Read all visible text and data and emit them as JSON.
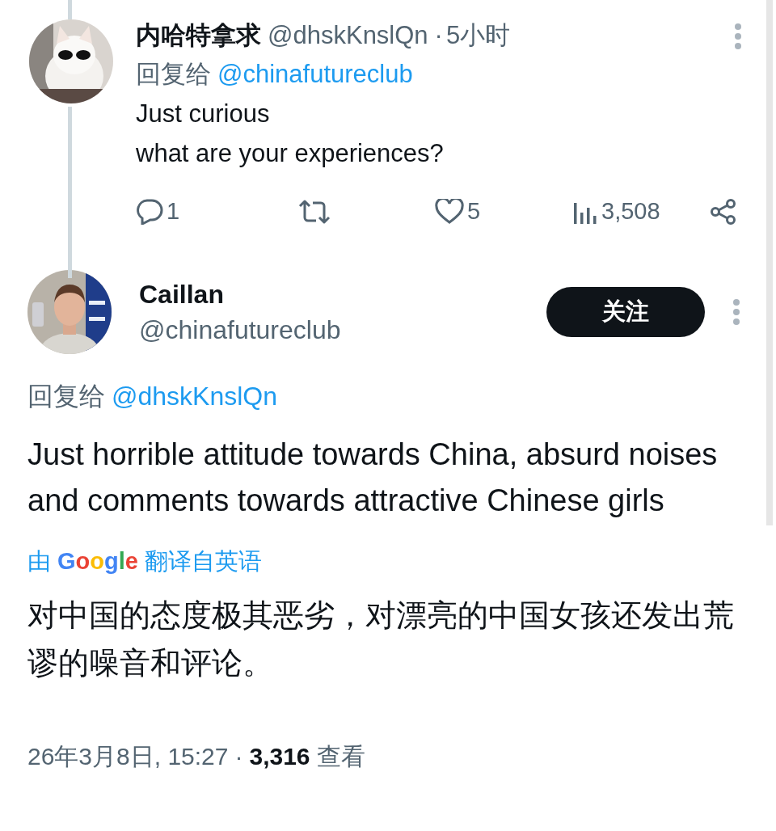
{
  "parent_tweet": {
    "display_name": "内哈特拿求",
    "handle": "@dhskKnslQn",
    "separator": "·",
    "time": "5小时",
    "reply_label": "回复给",
    "reply_to": "@chinafutureclub",
    "lines": [
      "Just curious",
      "what are your experiences?"
    ],
    "actions": [
      {
        "kind": "reply",
        "count": "1"
      },
      {
        "kind": "retweet"
      },
      {
        "kind": "like",
        "count": "5"
      },
      {
        "kind": "views",
        "count": "3,508"
      },
      {
        "kind": "share"
      }
    ]
  },
  "main_tweet": {
    "display_name": "Caillan",
    "handle": "@chinafutureclub",
    "follow_button": "关注",
    "reply_label": "回复给",
    "reply_to": "@dhskKnslQn",
    "text": "Just horrible attitude towards China, absurd noises and comments towards attractive Chinese girls",
    "translation_prefix": "由",
    "translation_provider": "Google",
    "translation_suffix": "翻译自英语",
    "translated_text": "对中国的态度极其恶劣，对漂亮的中国女孩还发出荒谬的噪音和评论。",
    "timestamp": "26年3月8日, 15:27",
    "dot": "·",
    "views_count": "3,316",
    "views_label": "查看"
  }
}
